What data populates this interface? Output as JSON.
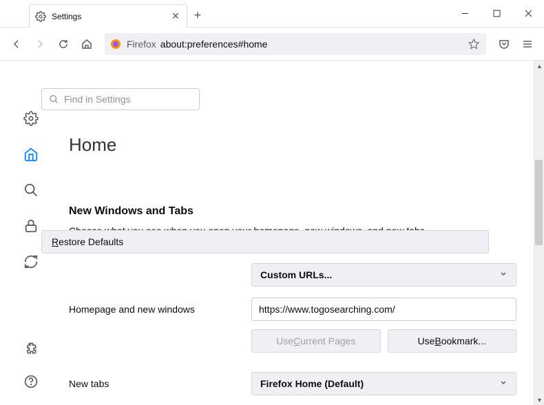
{
  "window": {
    "tab_title": "Settings",
    "new_tab": "+",
    "minimize": "—",
    "maximize": "▢",
    "close": "✕"
  },
  "toolbar": {
    "identity_label": "Firefox",
    "url": "about:preferences#home"
  },
  "search": {
    "placeholder": "Find in Settings"
  },
  "page": {
    "title": "Home",
    "restore_defaults": "Restore Defaults",
    "restore_key": "R"
  },
  "section": {
    "title": "New Windows and Tabs",
    "desc": "Choose what you see when you open your homepage, new windows, and new tabs."
  },
  "homepage": {
    "label": "Homepage and new windows",
    "dropdown": "Custom URLs...",
    "url_value": "https://www.togosearching.com/",
    "use_current": "Use Current Pages",
    "use_current_key": "C",
    "use_bookmark": "Use Bookmark...",
    "use_bookmark_key": "B"
  },
  "newtabs": {
    "label": "New tabs",
    "dropdown": "Firefox Home (Default)"
  }
}
